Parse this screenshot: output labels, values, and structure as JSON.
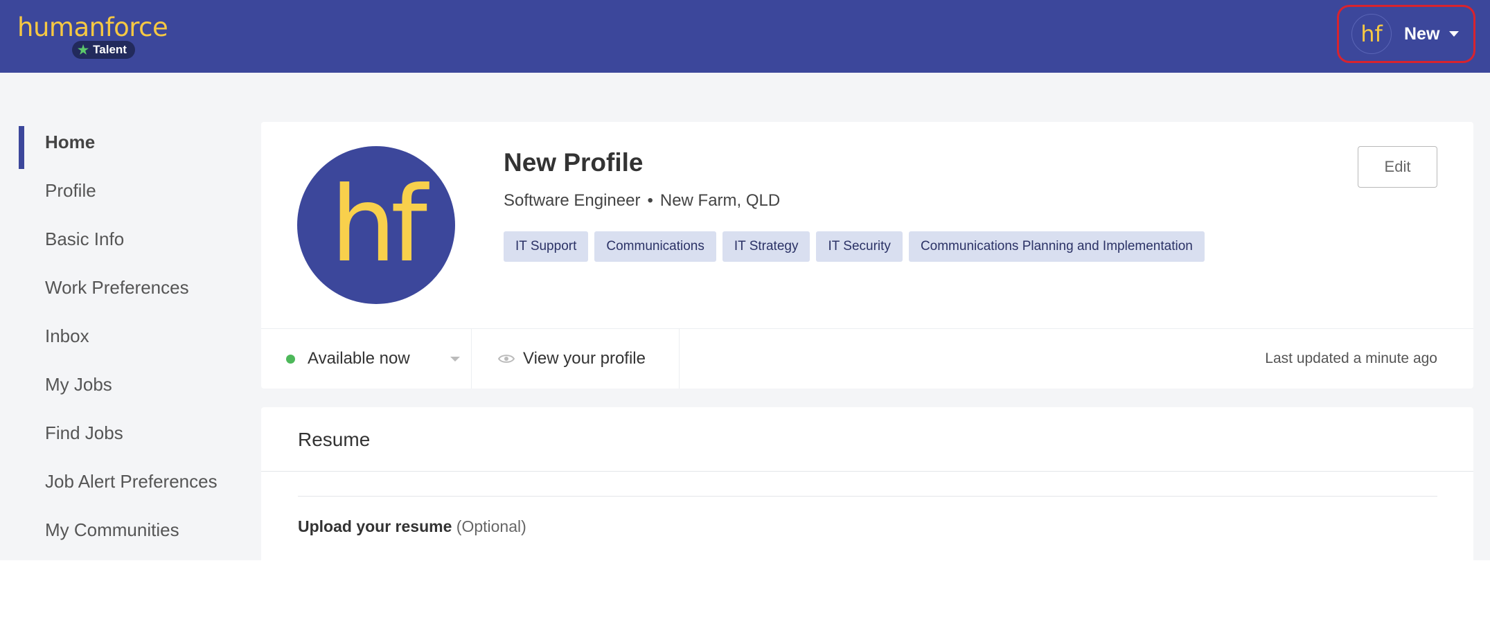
{
  "header": {
    "logo_text": "humanforce",
    "logo_badge": "Talent",
    "account": {
      "avatar_text": "hf",
      "name": "New"
    }
  },
  "sidebar": {
    "items": [
      {
        "label": "Home",
        "active": true
      },
      {
        "label": "Profile"
      },
      {
        "label": "Basic Info"
      },
      {
        "label": "Work Preferences"
      },
      {
        "label": "Inbox"
      },
      {
        "label": "My Jobs"
      },
      {
        "label": "Find Jobs"
      },
      {
        "label": "Job Alert Preferences"
      },
      {
        "label": "My Communities"
      }
    ]
  },
  "profile": {
    "avatar_text": "hf",
    "name": "New Profile",
    "title": "Software Engineer",
    "separator": "•",
    "location": "New Farm, QLD",
    "tags": [
      "IT Support",
      "Communications",
      "IT Strategy",
      "IT Security",
      "Communications Planning and Implementation"
    ],
    "edit_label": "Edit",
    "availability": "Available now",
    "view_label": "View your profile",
    "last_updated": "Last updated a minute ago"
  },
  "resume": {
    "title": "Resume",
    "upload_label": "Upload your resume",
    "upload_optional": "(Optional)"
  },
  "colors": {
    "brand": "#3c479b",
    "logo": "#f6c843",
    "available": "#4db85a",
    "highlight": "#d9232e"
  }
}
